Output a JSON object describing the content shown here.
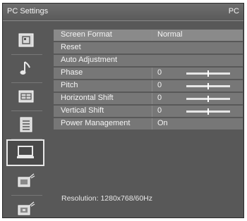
{
  "header": {
    "title": "PC Settings",
    "source": "PC"
  },
  "sidebar": {
    "items": [
      {
        "icon": "picture-icon",
        "active": false
      },
      {
        "icon": "music-note-icon",
        "active": false
      },
      {
        "icon": "screen-icon",
        "active": false
      },
      {
        "icon": "list-icon",
        "active": false
      },
      {
        "icon": "pc-monitor-icon",
        "active": true
      },
      {
        "icon": "pc-connect-icon",
        "active": false
      },
      {
        "icon": "pc-connect-alt-icon",
        "active": false
      }
    ]
  },
  "menu": {
    "rows": [
      {
        "label": "Screen Format",
        "value": "Normal"
      },
      {
        "label": "Reset",
        "value": ""
      },
      {
        "label": "Auto Adjustment",
        "value": ""
      },
      {
        "label": "Phase",
        "value": "0",
        "level": 0.5
      },
      {
        "label": "Pitch",
        "value": "0",
        "level": 0.5
      },
      {
        "label": "Horizontal Shift",
        "value": "0",
        "level": 0.5
      },
      {
        "label": "Vertical Shift",
        "value": "0",
        "level": 0.5
      },
      {
        "label": "Power Management",
        "value": "On"
      }
    ]
  },
  "status": {
    "resolution": "Resolution: 1280x768/60Hz"
  }
}
